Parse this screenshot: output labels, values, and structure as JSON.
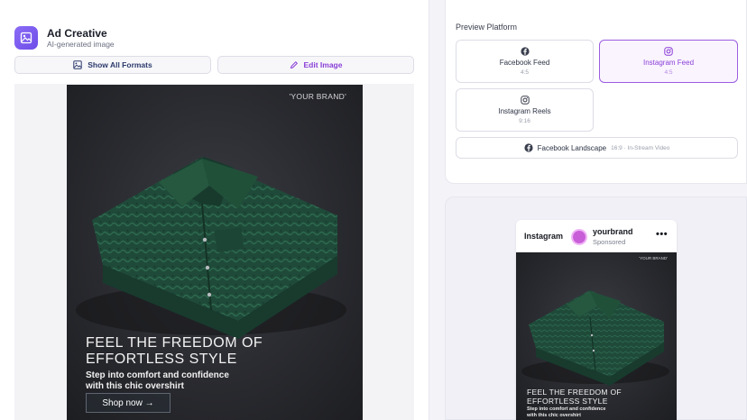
{
  "header": {
    "title": "Ad Creative",
    "subtitle": "AI-generated image",
    "icon": "image-icon",
    "accent": "#7a56f0"
  },
  "actions": {
    "show_formats_label": "Show All Formats",
    "edit_image_label": "Edit Image"
  },
  "creative": {
    "brand": "'YOUR BRAND'",
    "headline_line1": "FEEL THE FREEDOM OF",
    "headline_line2": "EFFORTLESS STYLE",
    "body_line1": "Step into comfort and confidence",
    "body_line2": "with this chic overshirt",
    "cta": "Shop now →",
    "subject": "folded green patterned overshirt"
  },
  "platform": {
    "heading": "Preview Platform",
    "options": [
      {
        "name": "Facebook Feed",
        "ratio": "4:5",
        "icon": "facebook-icon",
        "selected": false
      },
      {
        "name": "Instagram Feed",
        "ratio": "4:5",
        "icon": "instagram-icon",
        "selected": true
      },
      {
        "name": "Instagram Reels",
        "ratio": "9:16",
        "icon": "instagram-icon",
        "selected": false
      },
      {
        "name": "Facebook Landscape",
        "ratio": "16:9 · In-Stream Video",
        "icon": "facebook-icon",
        "selected": false
      }
    ],
    "selected_color": "#9b5ce0"
  },
  "preview": {
    "network": "Instagram",
    "username": "yourbrand",
    "sponsored": "Sponsored",
    "more": "•••",
    "brand": "'YOUR BRAND'",
    "headline_line1": "FEEL THE FREEDOM OF",
    "headline_line2": "EFFORTLESS STYLE",
    "body_line1": "Step into comfort and confidence",
    "body_line2": "with this chic overshirt"
  }
}
